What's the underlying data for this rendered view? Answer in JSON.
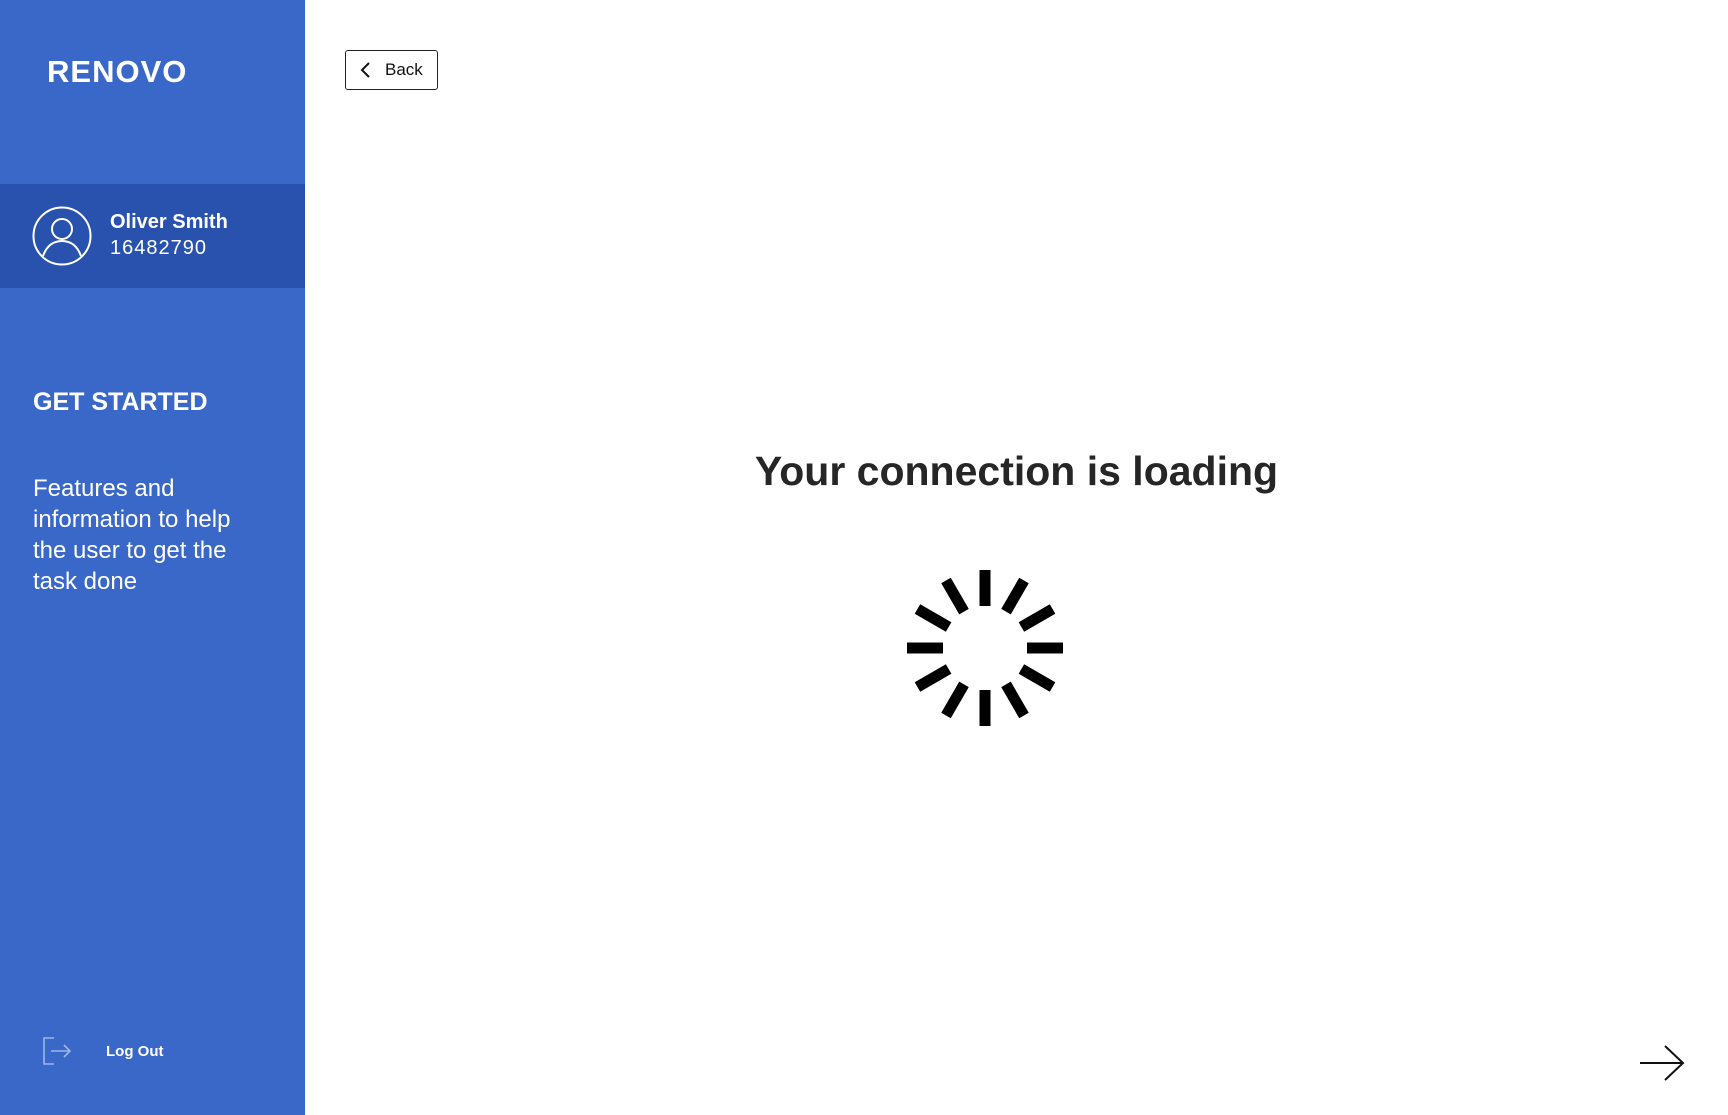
{
  "sidebar": {
    "logo": "RENOVO",
    "user": {
      "name": "Oliver Smith",
      "id": "16482790",
      "avatar_icon": "user-avatar-icon"
    },
    "section_title": "GET STARTED",
    "section_description": "Features and information to help the user to get the task done",
    "logout_label": "Log Out",
    "logout_icon": "logout-icon"
  },
  "toolbar": {
    "back_label": "Back",
    "back_icon": "chevron-left-icon"
  },
  "main": {
    "heading": "Your connection is loading",
    "spinner_icon": "loading-spinner-icon",
    "next_icon": "arrow-right-icon"
  },
  "colors": {
    "sidebar_bg": "#3a68c8",
    "user_card_bg": "#2952ae",
    "heading_text": "#262626",
    "spinner": "#000000"
  }
}
